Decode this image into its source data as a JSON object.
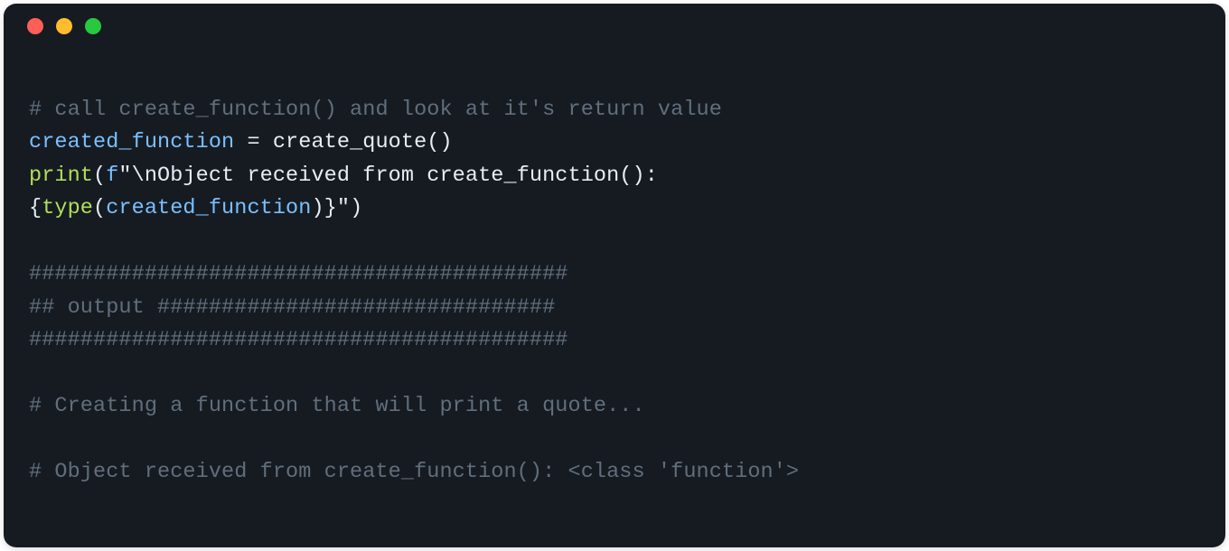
{
  "window": {
    "traffic_lights": [
      "close",
      "minimize",
      "maximize"
    ]
  },
  "code": {
    "line1_comment": "# call create_function() and look at it's return value",
    "line2_lhs": "created_function",
    "line2_op": " = ",
    "line2_rhs_func": "create_quote",
    "line2_rhs_call": "()",
    "line3_print": "print",
    "line3_open": "(",
    "line3_fprefix": "f",
    "line3_str1": "\"\\nObject received from create_function(): ",
    "line4_open_brace": "{",
    "line4_type": "type",
    "line4_inner_open": "(",
    "line4_inner_arg": "created_function",
    "line4_inner_close": ")",
    "line4_close_brace": "}",
    "line4_str2": "\"",
    "line4_close": ")",
    "sep1": "##########################################",
    "sep2": "## output ###############################",
    "sep3": "##########################################",
    "out1": "# Creating a function that will print a quote...",
    "out2": "# Object received from create_function(): <class 'function'>"
  }
}
